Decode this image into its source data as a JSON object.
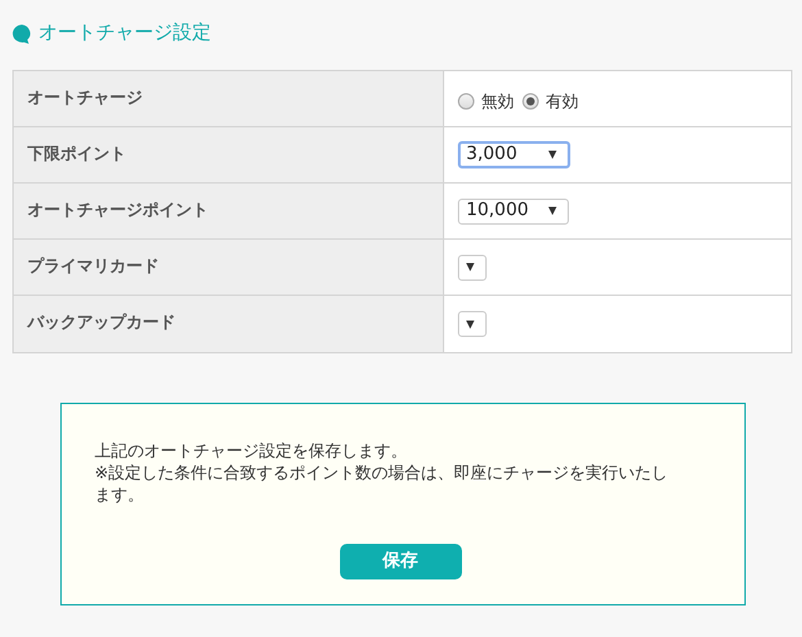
{
  "section_title": "オートチャージ設定",
  "rows": [
    {
      "label": "オートチャージ",
      "kind": "radio",
      "options": [
        {
          "label": "無効",
          "selected": false
        },
        {
          "label": "有効",
          "selected": true
        }
      ]
    },
    {
      "label": "下限ポイント",
      "kind": "select",
      "value": "3,000",
      "focused": true
    },
    {
      "label": "オートチャージポイント",
      "kind": "select",
      "value": "10,000",
      "focused": false
    },
    {
      "label": "プライマリカード",
      "kind": "select",
      "focused": false
    },
    {
      "label": "バックアップカード",
      "kind": "select",
      "focused": false
    }
  ],
  "notice": {
    "lines": [
      "上記のオートチャージ設定を保存します。",
      "※設定した条件に合致するポイント数の場合は、即座にチャージを実行いたします。"
    ],
    "button": "保存"
  }
}
